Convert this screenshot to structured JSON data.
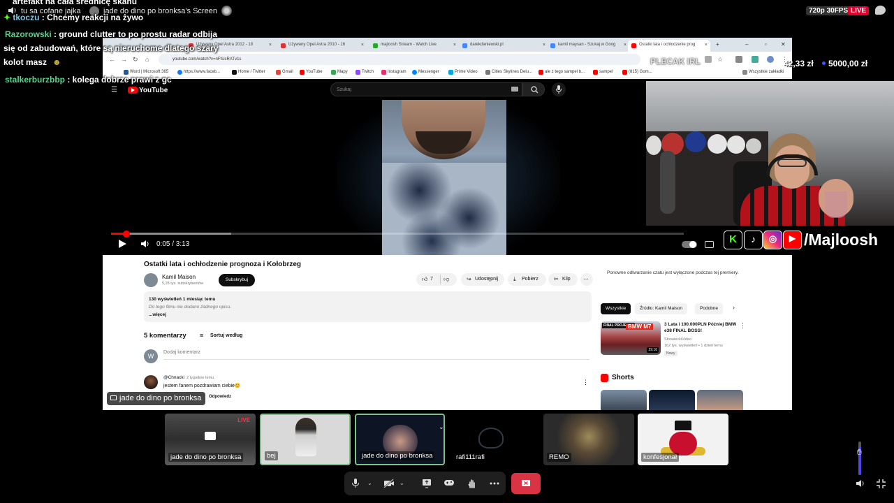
{
  "stream": {
    "tab1": "tu sa cofane jajka",
    "tab2": "jade do dino po bronksa's Screen",
    "quality": "720p 30FPS",
    "live": "LIVE"
  },
  "chat": [
    {
      "user": "",
      "text": "artefakt na cała średnicę skanu"
    },
    {
      "user": "tkoczu",
      "text": " : Chcemy reakcji na żywo"
    },
    {
      "user": "Razorowski",
      "text": " : ground clutter to po prostu radar odbija"
    },
    {
      "user": "",
      "text": "się od zabudowań, które są nieruchome dlatego szary"
    },
    {
      "user": "",
      "text": "kolot masz"
    },
    {
      "user": "stalkerburzbbp",
      "text": " : kolega dobrze prawi z gc"
    }
  ],
  "browser": {
    "tabs": [
      "Używany Opel Astra 2012 - 18",
      "Używany Opel Astra 2010 - 16",
      "majloosh Stream - Watch Live",
      "darekdaniewski.pl",
      "kamil maysan - Szukaj w Goog",
      "Ostatki lata i ochłodzenie prog"
    ],
    "url": "youtube.com/watch?v=nFtUcRATv1s",
    "bookmarks": [
      "Word | Microsoft 365",
      "https://www.faceb...",
      "Home / Twitter",
      "Gmail",
      "YouTube",
      "Mapy",
      "Twitch",
      "Instagram",
      "Messenger",
      "Prime Video",
      "Cities Skylines Delu...",
      "ale z tego sampel b...",
      "sampel",
      "(815) Gom...",
      "Wszystkie zakładki"
    ]
  },
  "overlay": {
    "pleca": "PLECAK IRL",
    "donation1": "42,33 zł",
    "donation2": "5000,00 zł",
    "handle": "/Majloosh",
    "presenter": "jade do dino po bronksa"
  },
  "youtube": {
    "logo": "YouTube",
    "search_placeholder": "Szukaj",
    "time": "0:05 / 3:13",
    "progress_played": 0.027,
    "progress_buffered": 0.21,
    "title": "Ostatki lata i ochłodzenie prognoza i Kołobrzeg",
    "channel": "Kamil Maison",
    "subs": "5,28 tys. subskrybentów",
    "subscribe": "Subskrybuj",
    "likes": "7",
    "share": "Udostępnij",
    "download": "Pobierz",
    "clip": "Klip",
    "views": "130 wyświetleń  1 miesiąc temu",
    "desc": "Do tego filmu nie dodano żadnego opisu.",
    "more": "...więcej",
    "comments_title": "5 komentarzy",
    "sort": "Sortuj według",
    "my_initial": "W",
    "add_comment": "Dodaj komentarz",
    "comment": {
      "author": "@Chnacki",
      "time": "2 tygodnie temu",
      "text": "jestem fanem pozdrawiam ciebie😊",
      "reply": "Odpowiedz"
    },
    "chat_replay": "Ponowne odtwarzanie czatu jest wyłączone podczas tej premiery.",
    "chips": [
      "Wszystkie",
      "Źródło: Kamil Maison",
      "Podobne"
    ],
    "rec": {
      "thumb_label": "FINAL PROJEKTU",
      "thumb_bmw": "BMW M7",
      "duration": "29:16",
      "title": "3 Lata i 100.000PLN Później BMW e38 FINAL BOSS!",
      "channel": "StrowieckiVideo",
      "stats": "162 tys. wyświetleń • 1 dzień temu",
      "badge": "Nowy"
    },
    "shorts": "Shorts"
  },
  "participants": [
    {
      "name": "jade do dino po bronksa",
      "live": "LIVE"
    },
    {
      "name": "bej"
    },
    {
      "name": "jade do dino po bronksa"
    },
    {
      "name": "rafi111rafi"
    },
    {
      "name": "REMO"
    },
    {
      "name": "konfesjonał"
    }
  ],
  "controls": {
    "volume_level": 0.85
  },
  "colors": {
    "live_red": "#e1002d",
    "yt_red": "#ff0000",
    "end_call": "#d93344",
    "chat_user": "#58d68d",
    "tile_active_border": "#7fbf8a"
  },
  "icons": [
    "speaker-icon",
    "chat-bubble-icon",
    "menu-icon",
    "search-icon",
    "microphone-icon",
    "play-icon",
    "volume-icon",
    "like-icon",
    "dislike-icon",
    "share-icon",
    "download-icon",
    "clip-icon",
    "more-icon",
    "sort-icon",
    "shorts-icon",
    "kick-icon",
    "tiktok-icon",
    "instagram-icon",
    "youtube-icon",
    "camera-off-icon",
    "present-icon",
    "gamepad-icon",
    "raise-hand-icon",
    "end-call-icon",
    "fullscreen-exit-icon"
  ]
}
